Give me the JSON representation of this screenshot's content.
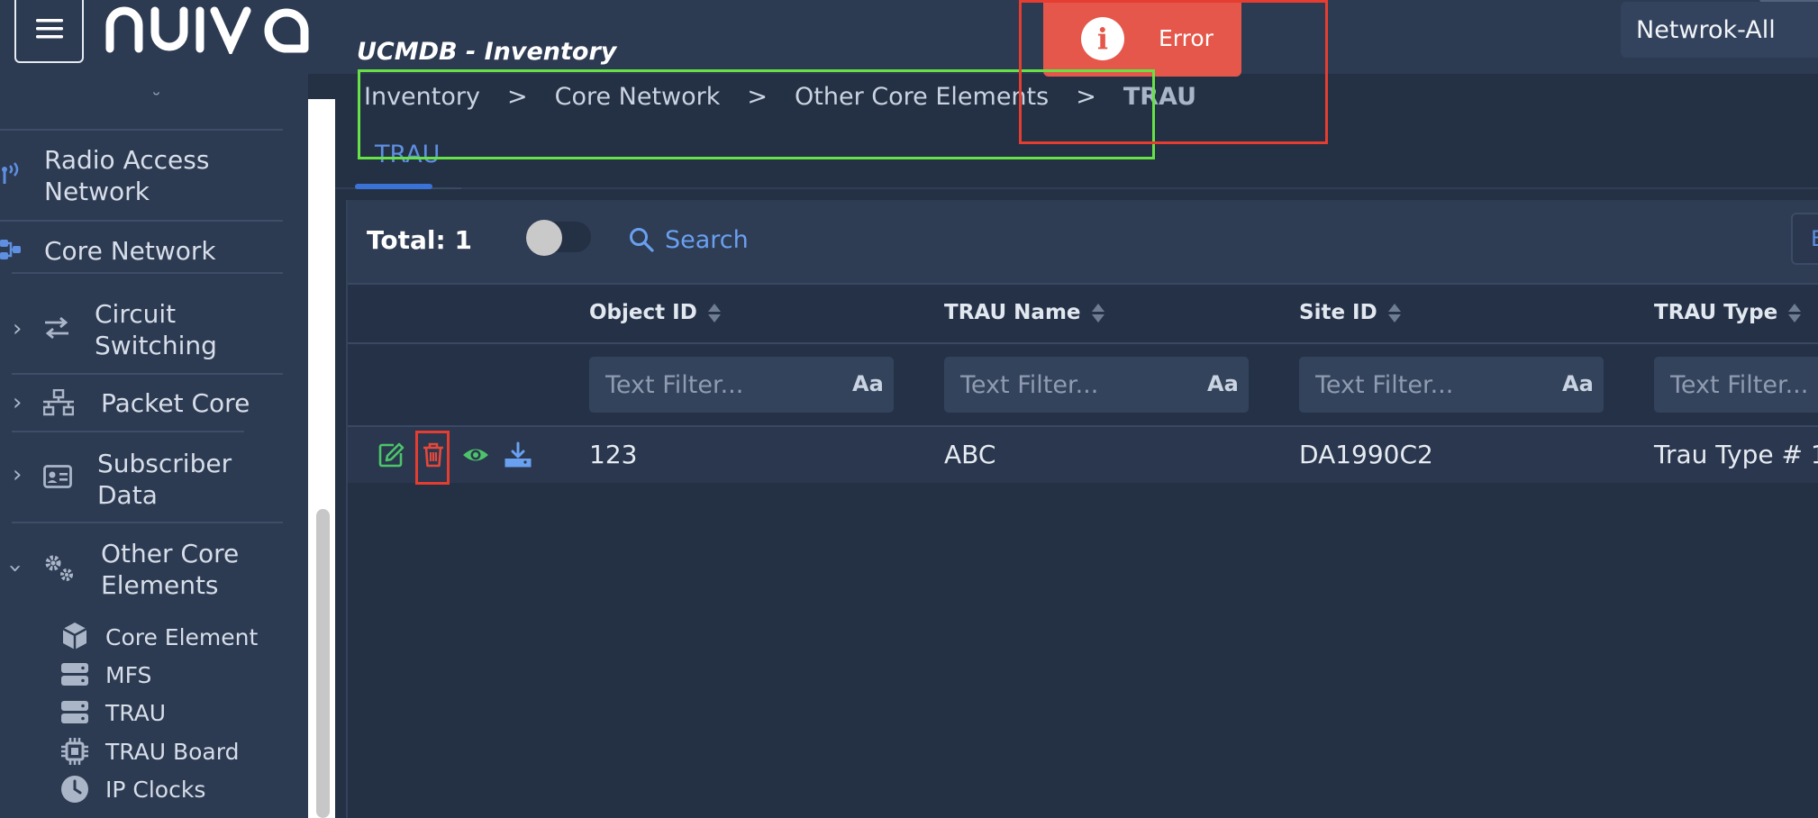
{
  "header": {
    "app_title": "UCMDB - Inventory",
    "network_select": "Netwrok-All"
  },
  "error_toast": {
    "text": "Error",
    "color": "#e4574a"
  },
  "breadcrumb": [
    "Inventory",
    "Core Network",
    "Other Core Elements",
    "TRAU"
  ],
  "breadcrumb_separator": ">",
  "tabs": [
    {
      "label": "TRAU",
      "active": true
    }
  ],
  "sidebar": {
    "scrolled_above_glyph": "˘",
    "items": [
      {
        "label_lines": [
          "Radio Access",
          "Network"
        ],
        "icon": "radio-tower-icon"
      },
      {
        "label_lines": [
          "Core Network"
        ],
        "icon": "network-nodes-icon"
      },
      {
        "label_lines": [
          "Circuit",
          "Switching"
        ],
        "icon": "exchange-arrows-icon",
        "expandable": true
      },
      {
        "label_lines": [
          "Packet Core"
        ],
        "icon": "network-tree-icon",
        "expandable": true
      },
      {
        "label_lines": [
          "Subscriber",
          "Data"
        ],
        "icon": "id-card-icon",
        "expandable": true
      },
      {
        "label_lines": [
          "Other Core",
          "Elements"
        ],
        "icon": "gears-icon",
        "expandable": true,
        "expanded": true
      }
    ],
    "sub_items": [
      {
        "label": "Core Element",
        "icon": "cube-icon"
      },
      {
        "label": "MFS",
        "icon": "server-icon"
      },
      {
        "label": "TRAU",
        "icon": "server-icon"
      },
      {
        "label": "TRAU Board",
        "icon": "chip-icon"
      },
      {
        "label": "IP Clocks",
        "icon": "clock-icon"
      }
    ]
  },
  "toolbar": {
    "total_label": "Total: 1",
    "search_label": "Search",
    "right_button_label": "E"
  },
  "table": {
    "columns": [
      "Object ID",
      "TRAU Name",
      "Site ID",
      "TRAU Type"
    ],
    "filter_placeholder": "Text Filter...",
    "filter_case_label": "Aa",
    "rows": [
      {
        "values": [
          "123",
          "ABC",
          "DA1990C2",
          "Trau Type # 1"
        ]
      }
    ],
    "row_actions": [
      "edit-icon",
      "trash-icon",
      "eye-icon",
      "download-icon"
    ]
  },
  "colors": {
    "accent": "#5e8fe0",
    "background": "#243044",
    "panel": "#2c3a52",
    "annotation_red": "#e53d2f",
    "annotation_green": "#66e246",
    "edit_green": "#4cc46a",
    "delete_red": "#e5483b"
  }
}
